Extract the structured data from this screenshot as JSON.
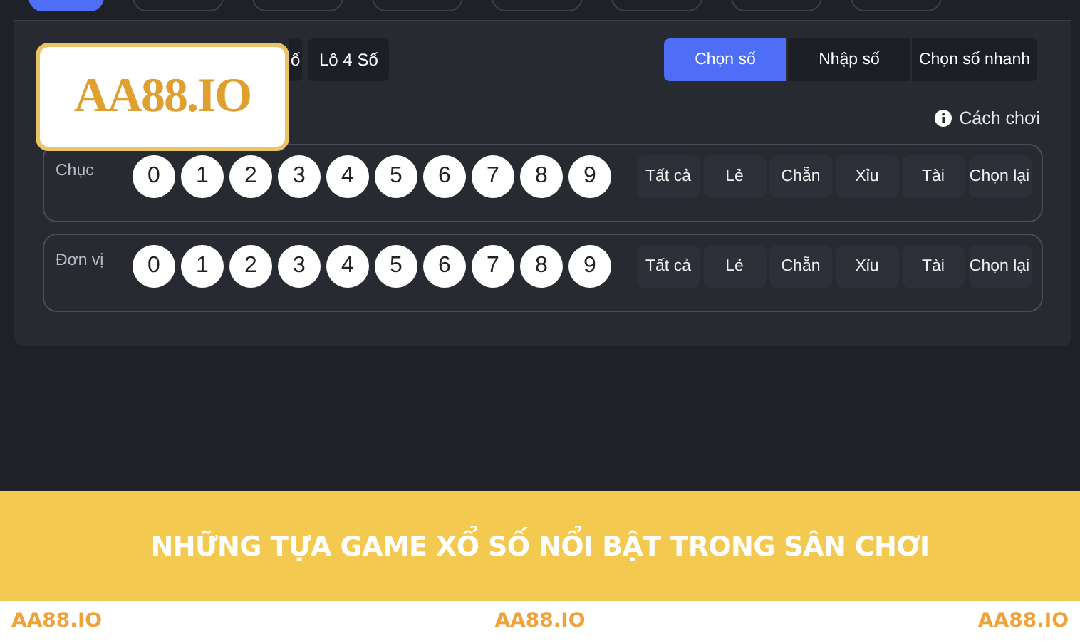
{
  "top_tabs": [
    {
      "selected": true
    },
    {
      "selected": false
    },
    {
      "selected": false
    },
    {
      "selected": false
    },
    {
      "selected": false
    },
    {
      "selected": false
    },
    {
      "selected": false
    },
    {
      "selected": false
    }
  ],
  "game_tabs": [
    {
      "label": "ố",
      "selected": false
    },
    {
      "label": "Lô 4 Số",
      "selected": false
    }
  ],
  "input_modes": [
    {
      "label": "Chọn số",
      "selected": true
    },
    {
      "label": "Nhập số",
      "selected": false
    },
    {
      "label": "Chọn số nhanh",
      "selected": false
    }
  ],
  "help_link": "Cách chơi",
  "rows": [
    {
      "label": "Chục",
      "numbers": [
        "0",
        "1",
        "2",
        "3",
        "4",
        "5",
        "6",
        "7",
        "8",
        "9"
      ],
      "actions": [
        "Tất cả",
        "Lẻ",
        "Chẵn",
        "Xỉu",
        "Tài",
        "Chọn lại"
      ]
    },
    {
      "label": "Đơn vị",
      "numbers": [
        "0",
        "1",
        "2",
        "3",
        "4",
        "5",
        "6",
        "7",
        "8",
        "9"
      ],
      "actions": [
        "Tất cả",
        "Lẻ",
        "Chẵn",
        "Xỉu",
        "Tài",
        "Chọn lại"
      ]
    }
  ],
  "logo": {
    "text": "AA88.IO"
  },
  "banner": {
    "title": "NHỮNG TỰA GAME XỔ SỐ NỔI BẬT TRONG SÂN CHƠI"
  },
  "footer_marks": [
    "AA88.IO",
    "AA88.IO",
    "AA88.IO"
  ]
}
